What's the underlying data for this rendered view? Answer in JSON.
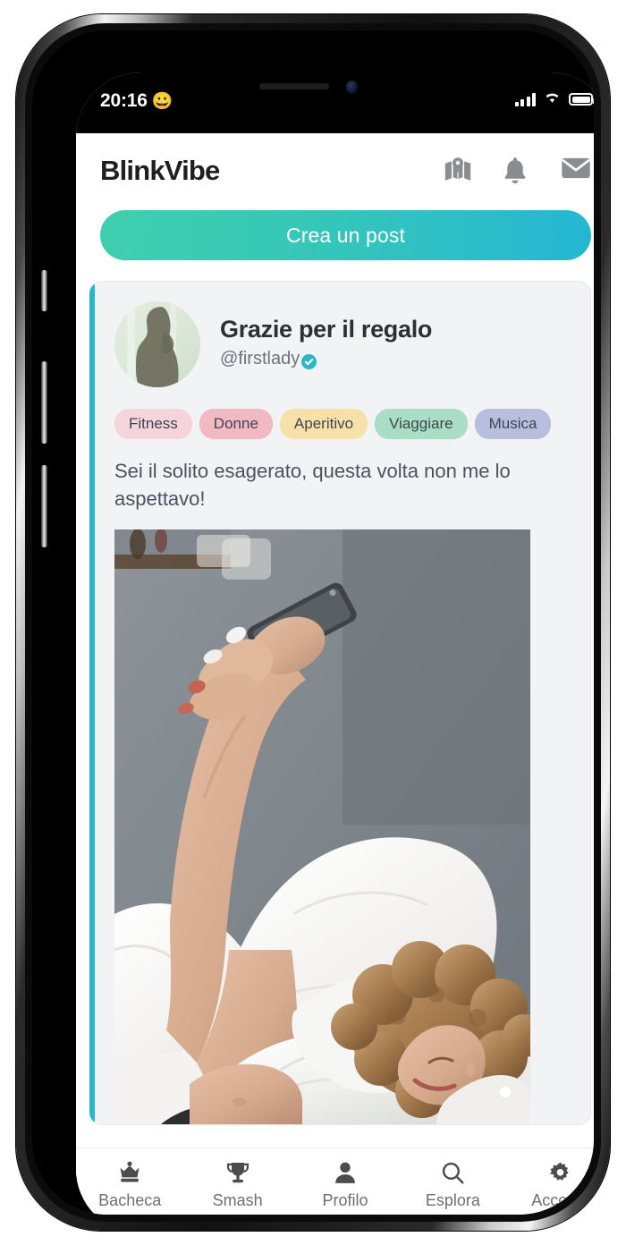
{
  "status_bar": {
    "time": "20:16",
    "emoji": "😀",
    "signal_icon": "cellular-signal-icon",
    "wifi_icon": "wifi-icon",
    "battery_icon": "battery-full-icon"
  },
  "header": {
    "brand": "BlinkVibe",
    "icons": [
      {
        "name": "map-icon",
        "label": "Mappa"
      },
      {
        "name": "bell-icon",
        "label": "Notifiche"
      },
      {
        "name": "envelope-icon",
        "label": "Messaggi"
      }
    ]
  },
  "actions": {
    "create_post_label": "Crea un post"
  },
  "post": {
    "title": "Grazie per il regalo",
    "handle": "@firstlady",
    "verified": true,
    "verified_icon": "verified-check-icon",
    "avatar_icon": "user-silhouette-avatar",
    "body": "Sei il solito esagerato, questa volta non me lo aspettavo!",
    "tags": [
      {
        "label": "Fitness",
        "color": "#f6d4dc"
      },
      {
        "label": "Donne",
        "color": "#f3b9c3"
      },
      {
        "label": "Aperitivo",
        "color": "#f7e1a8"
      },
      {
        "label": "Viaggiare",
        "color": "#a9ddc5"
      },
      {
        "label": "Musica",
        "color": "#b8bedd"
      }
    ],
    "media": {
      "alt": "Donna sdraiata a letto che guarda lo smartphone",
      "pagination_dots": 1,
      "active_dot": 1
    },
    "accent_color": "#2ab7c8"
  },
  "bottom_nav": {
    "items": [
      {
        "label": "Bacheca",
        "icon": "crown-icon"
      },
      {
        "label": "Smash",
        "icon": "trophy-icon"
      },
      {
        "label": "Profilo",
        "icon": "person-icon"
      },
      {
        "label": "Esplora",
        "icon": "search-icon"
      },
      {
        "label": "Account",
        "icon": "gear-icon"
      }
    ]
  },
  "theme": {
    "accent": "#2ab7c8",
    "gradient_start": "#3fcfae",
    "gradient_end": "#25b6d4",
    "card_bg": "#f2f3f5",
    "text_primary": "#2b2f36",
    "text_muted": "#6b7280"
  }
}
